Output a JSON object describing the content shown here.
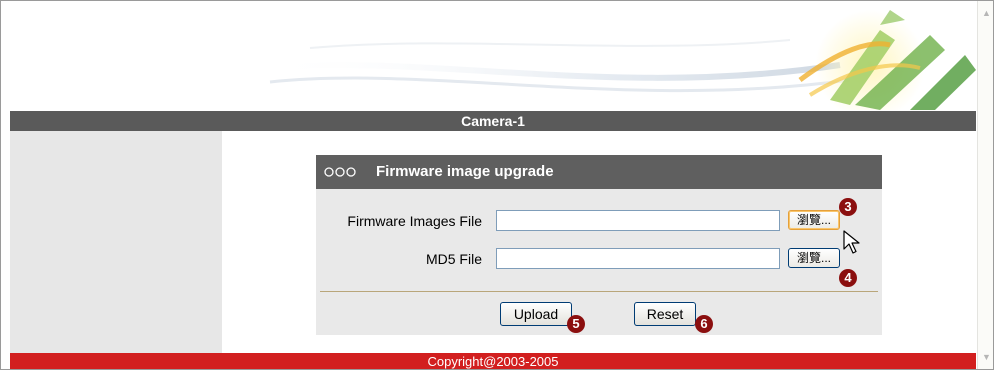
{
  "camera_title": "Camera-1",
  "card": {
    "title": "Firmware image upgrade",
    "firmware_label": "Firmware Images File",
    "md5_label": "MD5 File",
    "browse_label": "瀏覽...",
    "firmware_value": "",
    "md5_value": ""
  },
  "buttons": {
    "upload": "Upload",
    "reset": "Reset"
  },
  "markers": [
    "3",
    "4",
    "5",
    "6"
  ],
  "footer": "Copyright@2003-2005",
  "colors": {
    "title_bar": "#5a5a5a",
    "footer": "#d21f1f",
    "marker": "#8b0f0f",
    "left_panel": "#e7e7e7"
  }
}
